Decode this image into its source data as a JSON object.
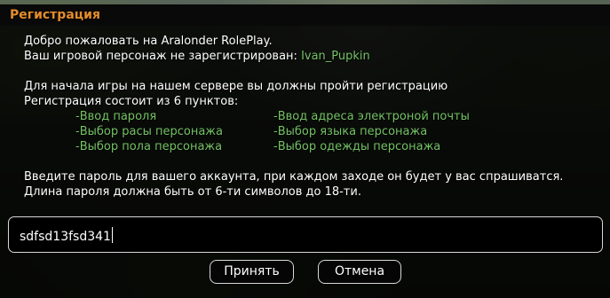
{
  "dialog": {
    "title": "Регистрация",
    "lines": {
      "welcome": "Добро пожаловать на Aralonder RolePlay.",
      "not_registered_prefix": "Ваш игровой персонаж не зарегистрирован: ",
      "player_name": "Ivan_Pupkin",
      "intro": "Для начала игры на нашем сервере вы должны пройти регистрацию",
      "steps_count": "Регистрация состоит из 6 пунктов:",
      "instruction": "Введите пароль для вашего аккаунта, при каждом заходе он будет у вас спрашиватся.",
      "length_rule": "Длина пароля должна быть от 6-ти символов до 18-ти."
    },
    "steps_left": [
      "-Ввод пароля",
      "-Выбор расы персонажа",
      "-Выбор пола персонажа"
    ],
    "steps_right": [
      "-Ввод адреса электроной почты",
      "-Выбор языка персонажа",
      "-Выбор одежды персонажа"
    ],
    "input": {
      "value": "sdfsd13fsd341"
    },
    "buttons": {
      "accept": "Принять",
      "cancel": "Отмена"
    }
  },
  "colors": {
    "title": "#e48d2c",
    "highlight": "#74c265",
    "text": "#ffffff",
    "panel": "#000000"
  }
}
